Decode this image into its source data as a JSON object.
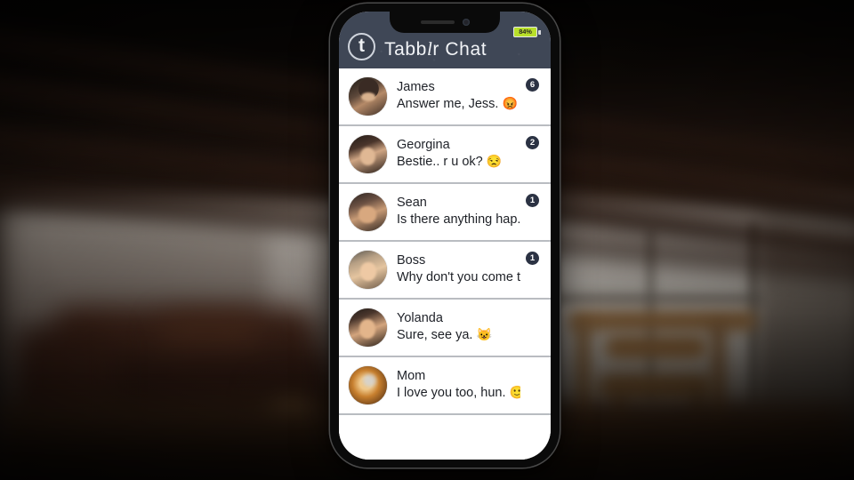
{
  "scene": {
    "description": "smartphone mockup over blurred dark room interior",
    "background_tone": "#211711"
  },
  "phone": {
    "notch": {
      "speaker": "speaker-slit",
      "camera": "front-camera"
    },
    "status": {
      "battery_percent": "84%",
      "battery_color": "#b9e02a"
    }
  },
  "app": {
    "logo_letter": "t",
    "title_part1": "Tabb",
    "title_script": "l",
    "title_part2": "r Chat",
    "header_color": "#3f4756",
    "badge_color": "#2b3243"
  },
  "chats": [
    {
      "name": "James",
      "preview": "Answer me, Jess.",
      "emoji": "😡",
      "badge": "6",
      "avatar": "av-james"
    },
    {
      "name": "Georgina",
      "preview": "Bestie.. r u ok?",
      "emoji": "😒",
      "badge": "2",
      "avatar": "av-georgina"
    },
    {
      "name": "Sean",
      "preview": "Is there anything hap...",
      "emoji": "",
      "badge": "1",
      "avatar": "av-sean"
    },
    {
      "name": "Boss",
      "preview": "Why don't you come t...",
      "emoji": "",
      "badge": "1",
      "avatar": "av-boss"
    },
    {
      "name": "Yolanda",
      "preview": "Sure, see ya.",
      "emoji": "😺",
      "badge": "",
      "avatar": "av-yolanda"
    },
    {
      "name": "Mom",
      "preview": "I love you too, hun.",
      "emoji": "🙂",
      "badge": "",
      "avatar": "av-mom"
    }
  ]
}
